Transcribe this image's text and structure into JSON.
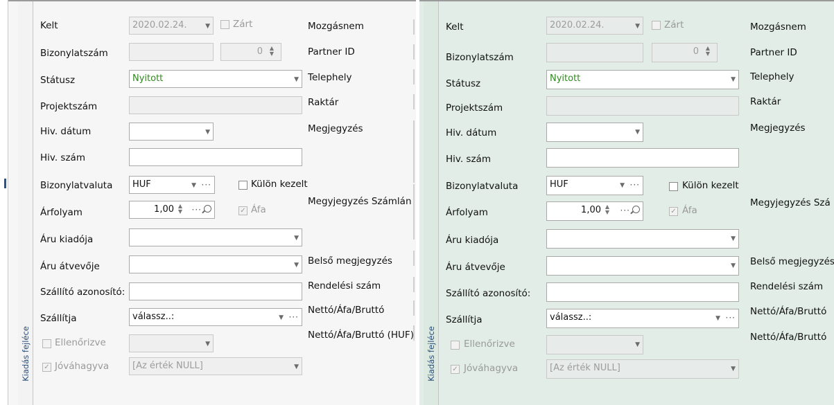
{
  "strip_title": "Kiadás fejléce",
  "labels": {
    "kelt": "Kelt",
    "bizonylatszam": "Bizonylatszám",
    "statusz": "Státusz",
    "projektszam": "Projektszám",
    "hiv_datum": "Hiv. dátum",
    "hiv_szam": "Hiv. szám",
    "bizonylatvaluta": "Bizonylatvaluta",
    "arfolyam": "Árfolyam",
    "aru_kiadoja": "Áru kiadója",
    "aru_atvevoje": "Áru átvevője",
    "szallito_azonosito": "Szállító azonosító:",
    "szallitja": "Szállítja",
    "ellenorizve": "Ellenőrizve",
    "jovahagyva": "Jóváhagyva"
  },
  "values": {
    "kelt_date": "2020.02.24.",
    "zart": "Zárt",
    "bizonylatszam_num": "0",
    "statusz": "Nyitott",
    "bizonylatvaluta": "HUF",
    "kulon_kezelt": "Külön kezelt",
    "arfolyam": "1,00",
    "afa": "Áfa",
    "szallitja": "válassz..:",
    "jovahagyva_value": "[Az érték NULL]"
  },
  "right_labels": {
    "mozgasnem": "Mozgásnem",
    "partner_id": "Partner ID",
    "telephely": "Telephely",
    "raktar": "Raktár",
    "megjegyzes": "Megjegyzés",
    "megjegyzes_szamlan_left": "Megyjegyzés Számlán",
    "megjegyzes_szamlan_right": "Megyjegyzés Szá",
    "belso_megjegyzes_left": "Belső megjegyzés",
    "belso_megjegyzes_right": "Belső megjegyzés",
    "rendelesi_szam": "Rendelési szám",
    "netto_afa_brutto": "Nettó/Áfa/Bruttó",
    "netto_afa_brutto_huf_left": "Nettó/Áfa/Bruttó (HUF)",
    "netto_afa_brutto_huf_right": "Nettó/Áfa/Bruttó"
  },
  "colors": {
    "status_green": "#2f8a1f",
    "strip_text": "#2b4f7a",
    "left_bg": "#f6f6f6",
    "right_bg": "#e1ede6"
  }
}
